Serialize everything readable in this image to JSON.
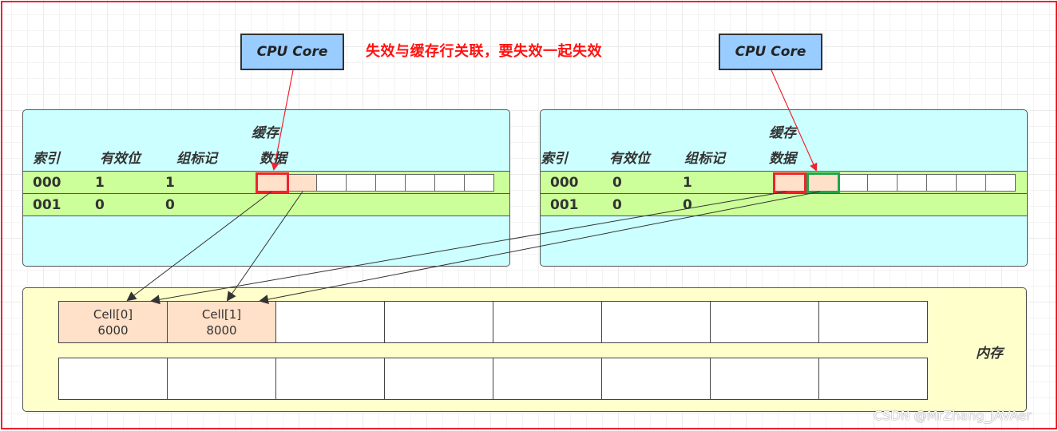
{
  "note": "失效与缓存行关联，要失效一起失效",
  "cpu_cores": [
    {
      "label": "CPU Core"
    },
    {
      "label": "CPU Core"
    }
  ],
  "caches": [
    {
      "header": {
        "index": "索引",
        "valid": "有效位",
        "tag": "组标记",
        "data_line1": "缓存",
        "data_line2": "数据"
      },
      "rows": [
        {
          "index": "000",
          "valid": "1",
          "tag": "1"
        },
        {
          "index": "001",
          "valid": "0",
          "tag": "0"
        }
      ],
      "line_cells": 8,
      "peach_cells": [
        0,
        1
      ],
      "highlight": {
        "red": 0
      }
    },
    {
      "header": {
        "index": "索引",
        "valid": "有效位",
        "tag": "组标记",
        "data_line1": "缓存",
        "data_line2": "数据"
      },
      "rows": [
        {
          "index": "000",
          "valid": "0",
          "tag": "1"
        },
        {
          "index": "001",
          "valid": "0",
          "tag": "0"
        }
      ],
      "line_cells": 8,
      "peach_cells": [
        0,
        1
      ],
      "highlight": {
        "red": 0,
        "green": 1
      }
    }
  ],
  "memory": {
    "label": "内存",
    "row1": [
      {
        "name": "Cell[0]",
        "value": "6000"
      },
      {
        "name": "Cell[1]",
        "value": "8000"
      },
      {
        "name": "",
        "value": ""
      },
      {
        "name": "",
        "value": ""
      },
      {
        "name": "",
        "value": ""
      },
      {
        "name": "",
        "value": ""
      },
      {
        "name": "",
        "value": ""
      },
      {
        "name": "",
        "value": ""
      }
    ],
    "row2_cells": 8
  },
  "watermark": "CSDN @MrZhang_JAVAer",
  "colors": {
    "cpu": "#99ccff",
    "cache_bg": "#ccffff",
    "row_bg": "#ccff99",
    "cell_peach": "#ffe0c8",
    "memory_bg": "#ffffcc",
    "invalid": "#f0232e",
    "valid": "#1fa54a",
    "note": "#ff1111"
  }
}
